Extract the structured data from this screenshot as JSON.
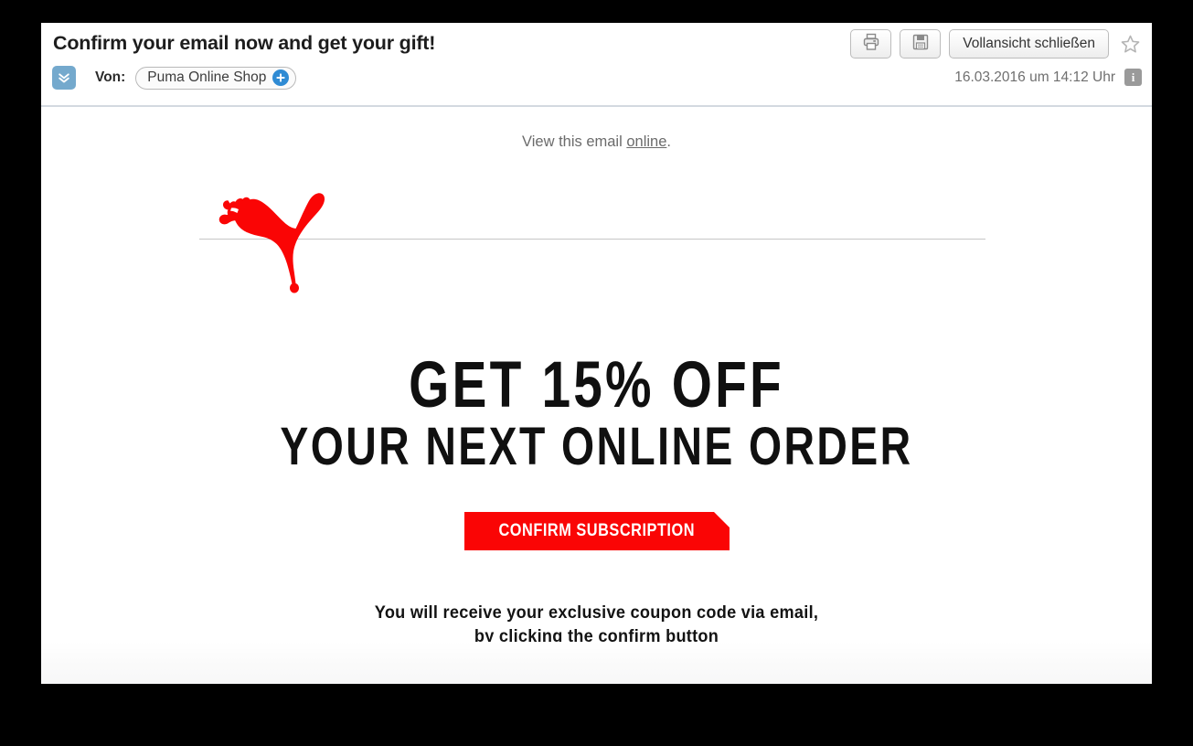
{
  "window": {
    "background_color": "#000000",
    "panel_color": "#ffffff"
  },
  "header": {
    "subject": "Confirm your email now and get your gift!",
    "expand_icon": "chevron-double-down-icon",
    "von_label": "Von:",
    "sender_name": "Puma Online Shop",
    "sender_add_icon": "plus-circle-icon",
    "timestamp": "16.03.2016 um 14:12 Uhr",
    "info_icon_label": "i",
    "toolbar": {
      "print_icon": "printer-icon",
      "save_icon": "floppy-disk-save-icon",
      "close_fullview_label": "Vollansicht schließen",
      "star_icon": "star-outline-icon"
    }
  },
  "email": {
    "view_online_prefix": "View this email ",
    "view_online_link": "online",
    "view_online_suffix": ".",
    "logo_alt": "puma-leaping-cat-logo",
    "logo_color": "#fa0505",
    "headline_line1": "GET 15% OFF",
    "headline_line2": "YOUR NEXT ONLINE ORDER",
    "cta_label": "CONFIRM SUBSCRIPTION",
    "cta_color": "#fa0505",
    "footnote_line1": "You will receive your exclusive coupon code via email,",
    "footnote_line2": "by clicking the confirm button"
  }
}
